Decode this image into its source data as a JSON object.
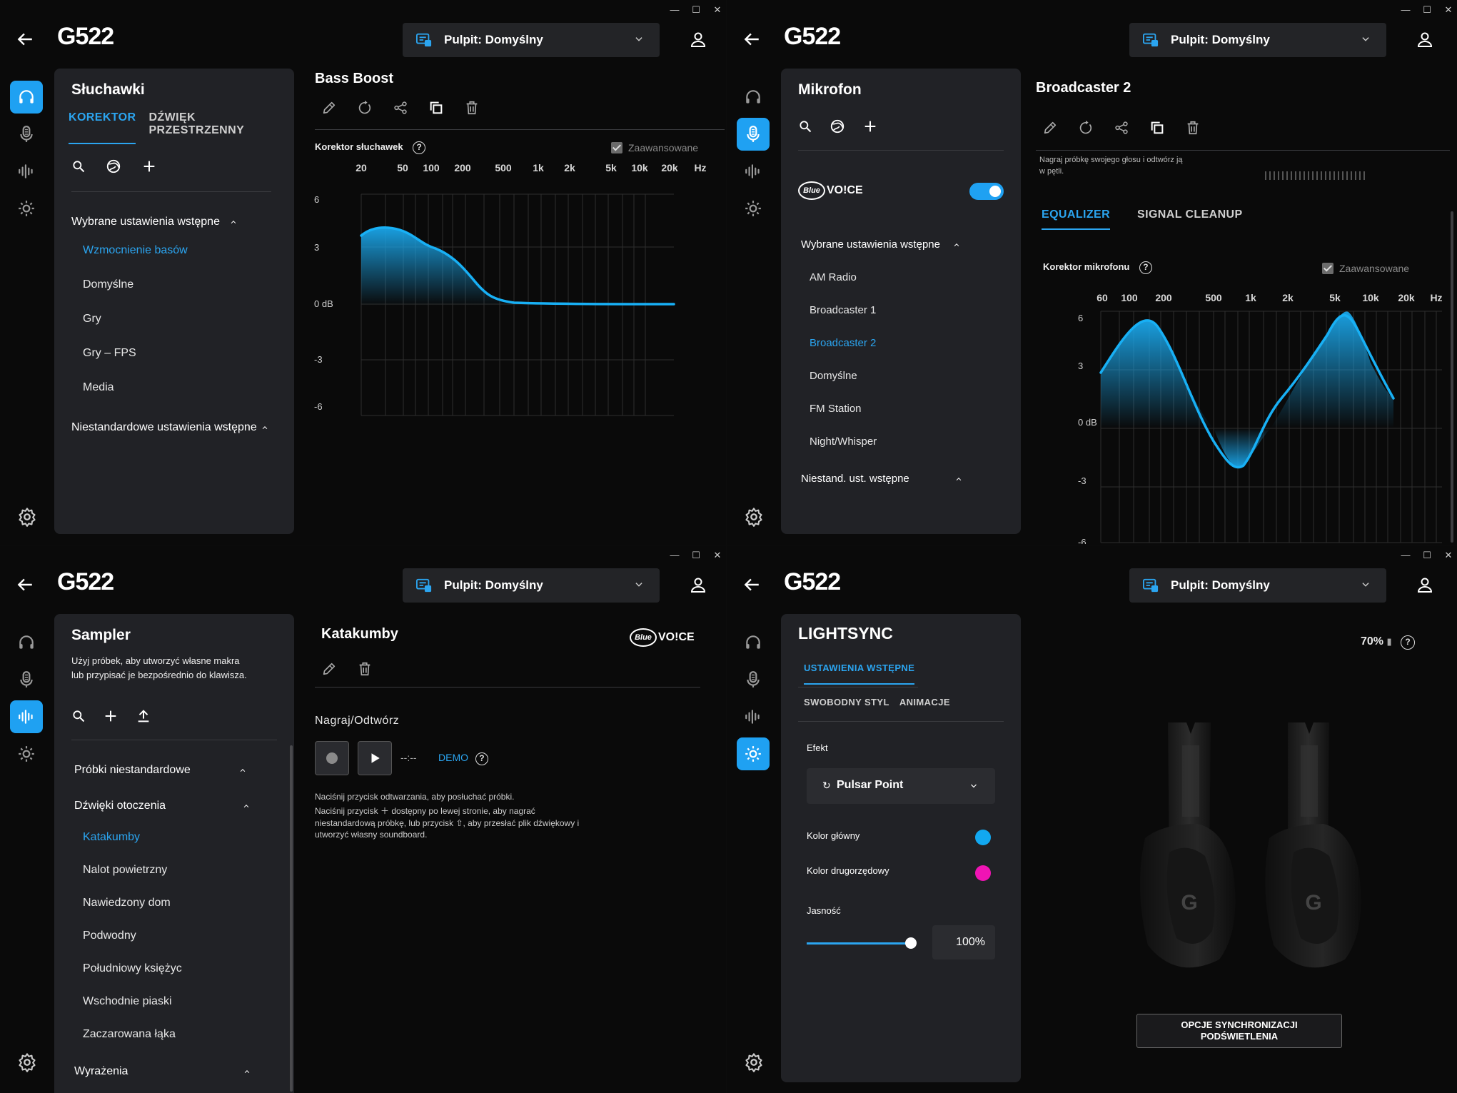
{
  "window_controls": {
    "minimize": "—",
    "maximize": "☐",
    "close": "✕"
  },
  "app_title": "G522",
  "profile_label": "Pulpit: Domyślny",
  "q1": {
    "panel_title": "Słuchawki",
    "tabs": [
      "KOREKTOR",
      "DŹWIĘK PRZESTRZENNY"
    ],
    "group_selected": "Wybrane ustawienia wstępne",
    "presets": [
      "Wzmocnienie basów",
      "Domyślne",
      "Gry",
      "Gry – FPS",
      "Media"
    ],
    "group_custom": "Niestandardowe ustawienia wstępne",
    "preset_title": "Bass Boost",
    "eq_label": "Korektor słuchawek",
    "advanced": "Zaawansowane",
    "freq_labels": [
      "20",
      "50",
      "100",
      "200",
      "500",
      "1k",
      "2k",
      "5k",
      "10k",
      "20k",
      "Hz"
    ],
    "db_labels": [
      "6",
      "3",
      "0 dB",
      "-3",
      "-6"
    ]
  },
  "q2": {
    "panel_title": "Mikrofon",
    "blue_voice_oval": "Blue",
    "blue_voice_text": "VO!CE",
    "group_selected": "Wybrane ustawienia wstępne",
    "presets": [
      "AM Radio",
      "Broadcaster 1",
      "Broadcaster 2",
      "Domyślne",
      "FM Station",
      "Night/Whisper"
    ],
    "group_custom": "Niestand. ust. wstępne",
    "preset_title": "Broadcaster 2",
    "hint_line1": "Nagraj próbkę swojego głosu i odtwórz ją",
    "hint_line2": "w pętli.",
    "tabs": [
      "EQUALIZER",
      "SIGNAL CLEANUP"
    ],
    "eq_label": "Korektor mikrofonu",
    "advanced": "Zaawansowane",
    "freq_labels": [
      "60",
      "100",
      "200",
      "500",
      "1k",
      "2k",
      "5k",
      "10k",
      "20k",
      "Hz"
    ],
    "db_labels": [
      "6",
      "3",
      "0 dB",
      "-3",
      "-6"
    ]
  },
  "q3": {
    "panel_title": "Sampler",
    "panel_desc1": "Użyj próbek, aby utworzyć własne makra",
    "panel_desc2": "lub przypisać je bezpośrednio do klawisza.",
    "group1": "Próbki niestandardowe",
    "group2": "Dźwięki otoczenia",
    "samples": [
      "Katakumby",
      "Nalot powietrzny",
      "Nawiedzony dom",
      "Podwodny",
      "Południowy księżyc",
      "Wschodnie piaski",
      "Zaczarowana łąka"
    ],
    "group3": "Wyrażenia",
    "sample_title": "Katakumby",
    "blue_voice_oval": "Blue",
    "blue_voice_text": "VO!CE",
    "record_label": "Nagraj/Odtwórz",
    "time": "--:--",
    "demo": "DEMO",
    "help1": "Naciśnij przycisk odtwarzania, aby posłuchać próbki.",
    "help2": "Naciśnij przycisk ＋ dostępny po lewej stronie, aby nagrać",
    "help3": "niestandardową próbkę, lub przycisk ⇧, aby przesłać plik dźwiękowy i",
    "help4": "utworzyć własny soundboard."
  },
  "q4": {
    "panel_title": "LIGHTSYNC",
    "tab_presets": "USTAWIENIA WSTĘPNE",
    "tab_freestyle": "SWOBODNY STYL",
    "tab_animations": "ANIMACJE",
    "effect_label": "Efekt",
    "effect_value": "Pulsar Point",
    "primary_color_label": "Kolor główny",
    "secondary_color_label": "Kolor drugorzędowy",
    "primary_color": "#12a8f0",
    "secondary_color": "#f014b4",
    "brightness_label": "Jasność",
    "brightness_value": "100%",
    "brightness_level": 1.0,
    "battery": "70%",
    "sync_button_line1": "OPCJE SYNCHRONIZACJI",
    "sync_button_line2": "PODŚWIETLENIA"
  },
  "colors": {
    "accent": "#2ba5f0",
    "panel": "#212226",
    "background": "#0a0a0a"
  }
}
